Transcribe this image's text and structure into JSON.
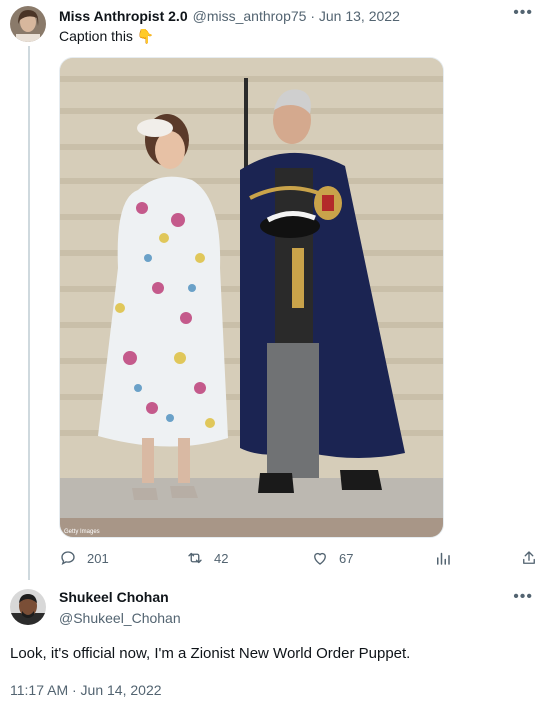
{
  "tweet": {
    "author_name": "Miss Anthropist 2.0",
    "handle_date": "@miss_anthrop75 · Jun 13, 2022",
    "text": "Caption this 👇",
    "watermark": "Getty Images",
    "stats": {
      "replies": "201",
      "retweets": "42",
      "likes": "67"
    }
  },
  "reply": {
    "author_name": "Shukeel Chohan",
    "handle": "@Shukeel_Chohan",
    "text": "Look, it's official now, I'm a Zionist New World Order Puppet.",
    "timestamp": "11:17 AM · Jun 14, 2022"
  },
  "icons": {
    "more": "more-icon",
    "reply": "reply-icon",
    "retweet": "retweet-icon",
    "like": "heart-icon",
    "analytics": "analytics-icon",
    "share": "share-icon"
  },
  "colors": {
    "text": "#0f1419",
    "muted": "#536471",
    "line": "#cfd9de"
  }
}
